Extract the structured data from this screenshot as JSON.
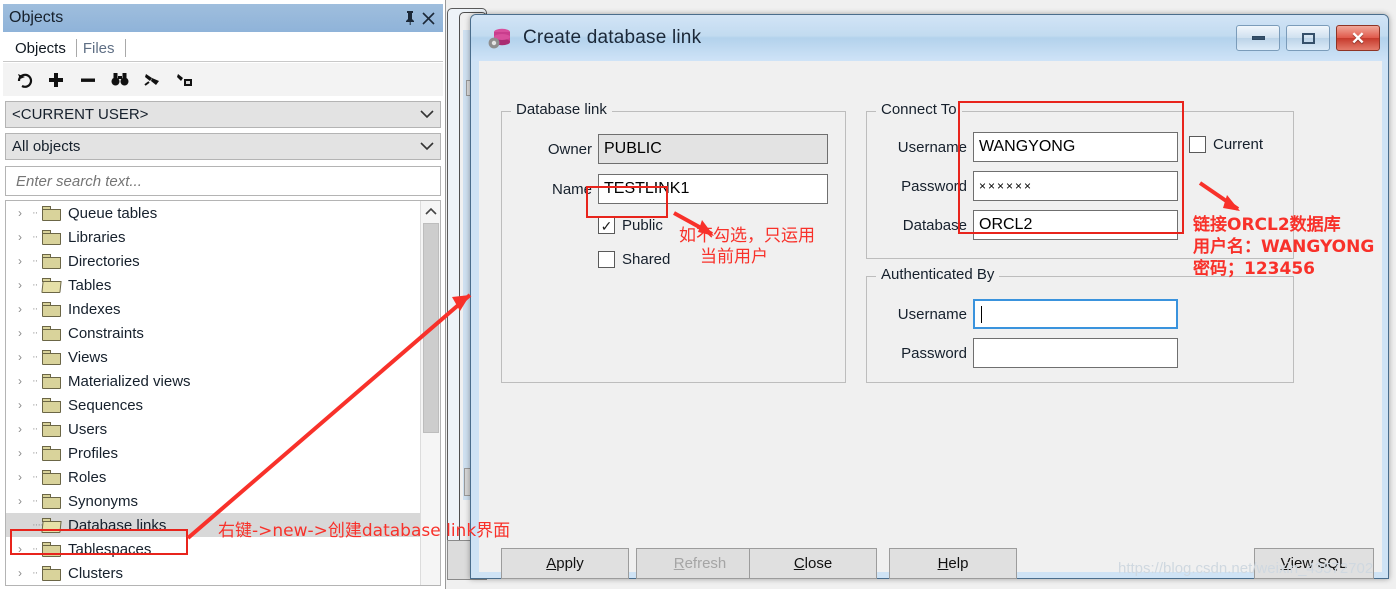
{
  "objects_panel": {
    "title": "Objects",
    "pin_icon": "pin-icon",
    "close_icon": "close-icon",
    "tabs": [
      {
        "label": "Objects",
        "active": true
      },
      {
        "label": "Files",
        "active": false
      }
    ],
    "toolbar_icons": [
      "refresh-icon",
      "add-icon",
      "remove-icon",
      "find-icon",
      "filter-icon",
      "tools-icon"
    ],
    "user_filter": "<CURRENT USER>",
    "object_filter": "All objects",
    "search_placeholder": "Enter search text...",
    "tree_items": [
      {
        "label": "Queue tables",
        "selected": false,
        "open": false
      },
      {
        "label": "Libraries",
        "selected": false,
        "open": false
      },
      {
        "label": "Directories",
        "selected": false,
        "open": false
      },
      {
        "label": "Tables",
        "selected": false,
        "open": true
      },
      {
        "label": "Indexes",
        "selected": false,
        "open": false
      },
      {
        "label": "Constraints",
        "selected": false,
        "open": false
      },
      {
        "label": "Views",
        "selected": false,
        "open": false
      },
      {
        "label": "Materialized views",
        "selected": false,
        "open": false
      },
      {
        "label": "Sequences",
        "selected": false,
        "open": false
      },
      {
        "label": "Users",
        "selected": false,
        "open": false
      },
      {
        "label": "Profiles",
        "selected": false,
        "open": false
      },
      {
        "label": "Roles",
        "selected": false,
        "open": false
      },
      {
        "label": "Synonyms",
        "selected": false,
        "open": false
      },
      {
        "label": "Database links",
        "selected": true,
        "open": true
      },
      {
        "label": "Tablespaces",
        "selected": false,
        "open": false
      },
      {
        "label": "Clusters",
        "selected": false,
        "open": false
      }
    ]
  },
  "dialog": {
    "title": "Create database link",
    "icon": "database-gear-icon",
    "window_buttons": {
      "minimize": "minimize-icon",
      "maximize": "maximize-icon",
      "close": "close-icon"
    },
    "database_link_group": {
      "legend": "Database link",
      "owner_label": "Owner",
      "owner_value": "PUBLIC",
      "name_label": "Name",
      "name_value": "TESTLINK1",
      "public_label": "Public",
      "public_checked": true,
      "public_tick": "✓",
      "shared_label": "Shared",
      "shared_checked": false
    },
    "connect_to_group": {
      "legend": "Connect To",
      "username_label": "Username",
      "username_value": "WANGYONG",
      "password_label": "Password",
      "password_value": "××××××",
      "database_label": "Database",
      "database_value": "ORCL2",
      "current_label": "Current",
      "current_checked": false
    },
    "authenticated_by_group": {
      "legend": "Authenticated By",
      "username_label": "Username",
      "username_value": "",
      "password_label": "Password",
      "password_value": ""
    },
    "buttons": {
      "apply": {
        "prefix": "",
        "mnemonic": "A",
        "suffix": "pply",
        "disabled": false
      },
      "refresh": {
        "prefix": "",
        "mnemonic": "R",
        "suffix": "efresh",
        "disabled": true
      },
      "close": {
        "prefix": "",
        "mnemonic": "C",
        "suffix": "lose",
        "disabled": false
      },
      "help": {
        "prefix": "",
        "mnemonic": "H",
        "suffix": "elp",
        "disabled": false
      },
      "view_sql": {
        "prefix": "",
        "mnemonic": "V",
        "suffix": "iew SQL",
        "disabled": false
      }
    }
  },
  "annotations": {
    "tree_note": "右键->new->创建database link界面",
    "public_note_line1": "如不勾选，只运用",
    "public_note_line2": "当前用户",
    "connect_note_line1": "链接ORCL2数据库",
    "connect_note_line2": "用户名：WANGYONG",
    "connect_note_line3": "密码；123456",
    "color": "#f8312a"
  },
  "watermark": "https://blog.csdn.net/weixin_43572702"
}
